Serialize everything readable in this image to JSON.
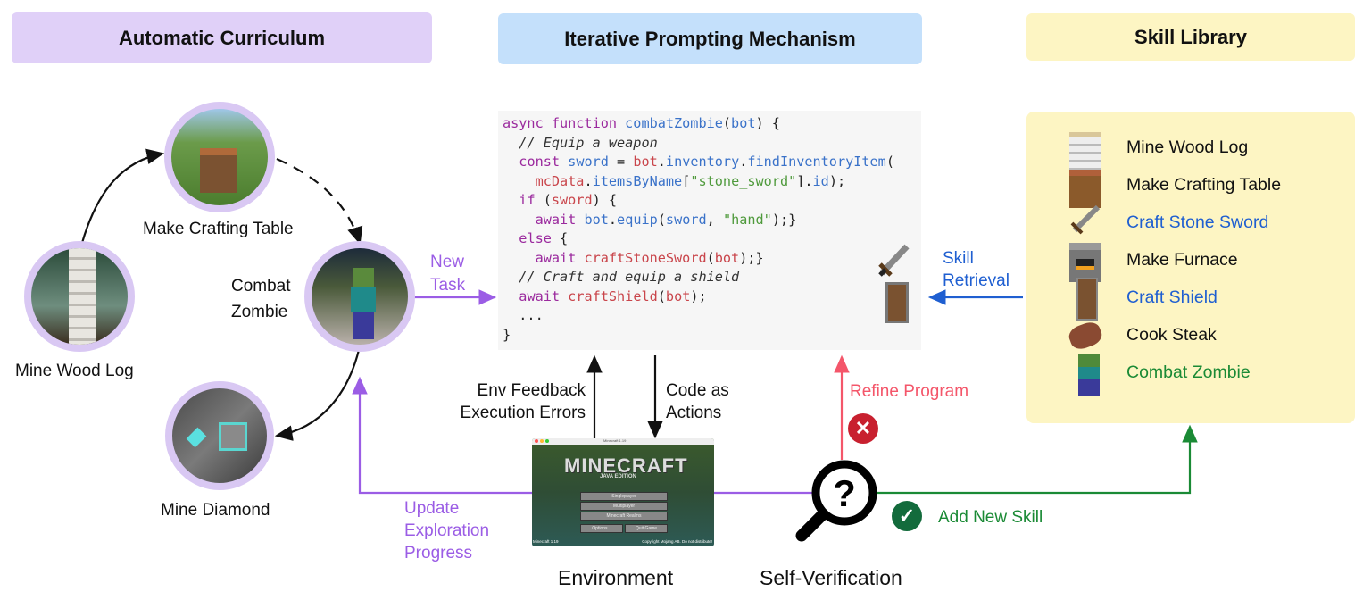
{
  "headers": {
    "curriculum": "Automatic Curriculum",
    "prompting": "Iterative Prompting Mechanism",
    "library": "Skill Library"
  },
  "colors": {
    "curriculum_bg": "#e0d0f8",
    "prompting_bg": "#c4e0fb",
    "library_bg": "#fdf5c3",
    "purple": "#9b5de5",
    "blue": "#1f5fd1",
    "red": "#f4566a",
    "green": "#1a8a35"
  },
  "curriculum": {
    "tasks": [
      {
        "label": "Mine Wood Log"
      },
      {
        "label": "Make Crafting Table"
      },
      {
        "label_line1": "Combat",
        "label_line2": "Zombie"
      },
      {
        "label": "Mine Diamond"
      }
    ],
    "new_task_line1": "New",
    "new_task_line2": "Task"
  },
  "code": {
    "lines": [
      "async function combatZombie(bot) {",
      "  // Equip a weapon",
      "  const sword = bot.inventory.findInventoryItem(",
      "    mcData.itemsByName[\"stone_sword\"].id);",
      "  if (sword) {",
      "    await bot.equip(sword, \"hand\");}",
      "  else {",
      "    await craftStoneSword(bot);}",
      "  // Craft and equip a shield",
      "  await craftShield(bot);",
      "  ...",
      "}"
    ]
  },
  "arrows": {
    "env_feedback_line1": "Env Feedback",
    "env_feedback_line2": "Execution Errors",
    "code_actions_line1": "Code as",
    "code_actions_line2": "Actions",
    "refine": "Refine Program",
    "skill_retrieval_line1": "Skill",
    "skill_retrieval_line2": "Retrieval",
    "update_line1": "Update",
    "update_line2": "Exploration",
    "update_line3": "Progress",
    "add_skill": "Add New Skill"
  },
  "environment": {
    "label": "Environment",
    "window_title": "Minecraft 1.19",
    "logo": "MINECRAFT",
    "edition": "JAVA EDITION",
    "buttons": [
      "Singleplayer",
      "Multiplayer",
      "Minecraft Realms",
      "Options...",
      "Quit Game"
    ],
    "version": "Minecraft 1.19",
    "copyright": "Copyright Mojang AB. Do not distribute!"
  },
  "verification": {
    "label": "Self-Verification"
  },
  "library": {
    "skills": [
      {
        "label": "Mine Wood  Log",
        "color": "#222222",
        "icon": "birch-log-icon"
      },
      {
        "label": "Make Crafting Table",
        "color": "#222222",
        "icon": "crafting-table-icon"
      },
      {
        "label": "Craft Stone Sword",
        "color": "#1f5fd1",
        "icon": "stone-sword-icon"
      },
      {
        "label": "Make Furnace",
        "color": "#111111",
        "icon": "furnace-icon"
      },
      {
        "label": "Craft Shield",
        "color": "#1f5fd1",
        "icon": "shield-icon"
      },
      {
        "label": "Cook Steak",
        "color": "#111111",
        "icon": "steak-icon"
      },
      {
        "label": "Combat Zombie",
        "color": "#1a8a35",
        "icon": "zombie-icon"
      }
    ]
  }
}
